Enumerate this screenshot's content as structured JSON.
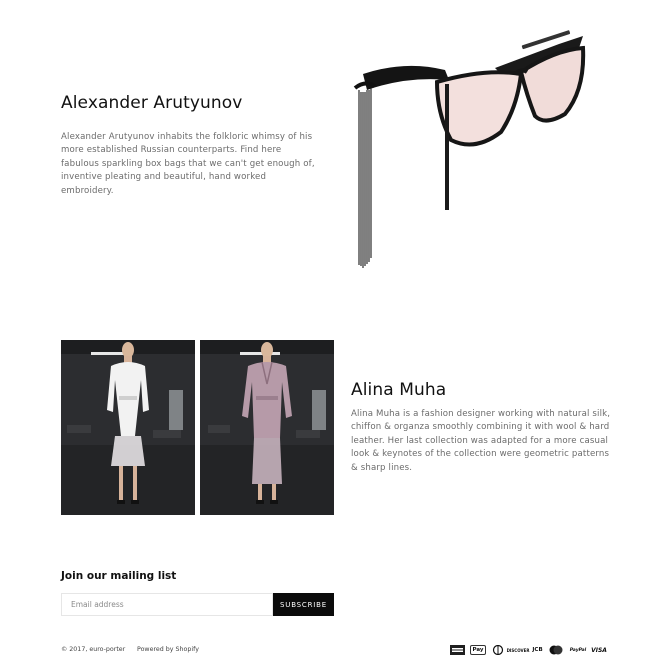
{
  "designers": [
    {
      "name": "Alexander Arutyunov",
      "description": "Alexander Arutyunov inhabits the folkloric whimsy of his more established Russian counterparts. Find here fabulous sparkling box bags that we can't get enough of, inventive pleating and beautiful, hand worked embroidery."
    },
    {
      "name": "Alina Muha",
      "description": "Alina Muha is a fashion designer working with natural silk, chiffon & organza smoothly combining it with wool & hard leather. Her last collection was adapted for a more casual look & keynotes of the collection were geometric patterns & sharp lines."
    }
  ],
  "newsletter": {
    "title": "Join our mailing list",
    "email_placeholder": "Email address",
    "subscribe_label": "SUBSCRIBE"
  },
  "footer": {
    "copyright": "© 2017, euro-porter",
    "powered_by": "Powered by Shopify",
    "payment_icons": [
      "american-express-icon",
      "apple-pay-icon",
      "diners-club-icon",
      "discover-icon",
      "jcb-icon",
      "master-icon",
      "paypal-icon",
      "visa-icon"
    ],
    "payment_text": {
      "apple_pay": "Pay",
      "discover": "DISCOVER",
      "jcb": "JCB",
      "paypal": "PayPal",
      "visa": "VISA"
    }
  },
  "colors": {
    "accent": "#0b0b0b",
    "body_text": "#6b6b6b",
    "heading": "#111111"
  }
}
